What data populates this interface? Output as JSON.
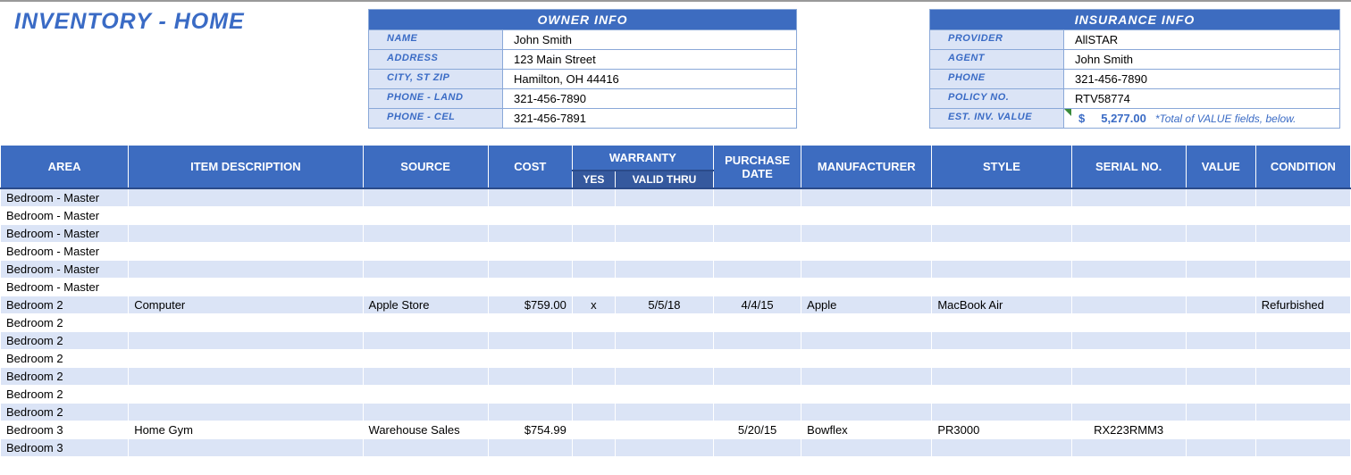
{
  "title": "INVENTORY - HOME",
  "owner": {
    "header": "OWNER INFO",
    "labels": {
      "name": "NAME",
      "address": "ADDRESS",
      "csz": "CITY, ST  ZIP",
      "land": "PHONE - LAND",
      "cel": "PHONE - CEL"
    },
    "name": "John Smith",
    "address": "123 Main Street",
    "csz": "Hamilton, OH  44416",
    "land": "321-456-7890",
    "cel": "321-456-7891"
  },
  "insurance": {
    "header": "INSURANCE INFO",
    "labels": {
      "provider": "PROVIDER",
      "agent": "AGENT",
      "phone": "PHONE",
      "policy": "POLICY NO.",
      "est": "EST. INV. VALUE"
    },
    "provider": "AllSTAR",
    "agent": "John Smith",
    "phone": "321-456-7890",
    "policy": "RTV58774",
    "est_dollar": "$",
    "est_amount": "5,277.00",
    "est_note": "*Total of VALUE fields, below."
  },
  "headers": {
    "area": "AREA",
    "desc": "ITEM DESCRIPTION",
    "source": "SOURCE",
    "cost": "COST",
    "warranty": "WARRANTY",
    "wyes": "YES",
    "wthru": "VALID THRU",
    "pdate": "PURCHASE DATE",
    "manu": "MANUFACTURER",
    "style": "STYLE",
    "serial": "SERIAL NO.",
    "value": "VALUE",
    "cond": "CONDITION"
  },
  "rows": [
    {
      "area": "Bedroom - Master"
    },
    {
      "area": "Bedroom - Master"
    },
    {
      "area": "Bedroom - Master"
    },
    {
      "area": "Bedroom - Master"
    },
    {
      "area": "Bedroom - Master"
    },
    {
      "area": "Bedroom - Master"
    },
    {
      "area": "Bedroom 2",
      "desc": "Computer",
      "source": "Apple Store",
      "cost": "$759.00",
      "wyes": "x",
      "wthru": "5/5/18",
      "pdate": "4/4/15",
      "manu": "Apple",
      "style": "MacBook Air",
      "serial": "",
      "value": "",
      "cond": "Refurbished"
    },
    {
      "area": "Bedroom 2"
    },
    {
      "area": "Bedroom 2"
    },
    {
      "area": "Bedroom 2"
    },
    {
      "area": "Bedroom 2"
    },
    {
      "area": "Bedroom 2"
    },
    {
      "area": "Bedroom 2"
    },
    {
      "area": "Bedroom 3",
      "desc": "Home Gym",
      "source": "Warehouse Sales",
      "cost": "$754.99",
      "wyes": "",
      "wthru": "",
      "pdate": "5/20/15",
      "manu": "Bowflex",
      "style": "PR3000",
      "serial": "RX223RMM3",
      "value": "",
      "cond": ""
    },
    {
      "area": "Bedroom 3"
    }
  ]
}
